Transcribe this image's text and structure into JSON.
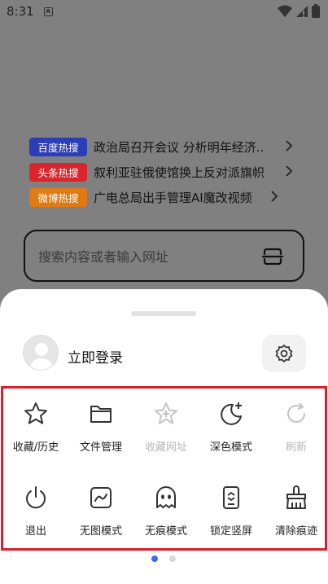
{
  "status_bar": {
    "time": "8:31",
    "app_icon_letter": "A"
  },
  "hot_searches": [
    {
      "badge": "百度热搜",
      "color": "#2c3db8",
      "text": "政治局召开会议 分析明年经济.."
    },
    {
      "badge": "头条热搜",
      "color": "#d9262c",
      "text": "叙利亚驻俄使馆换上反对派旗帜"
    },
    {
      "badge": "微博热搜",
      "color": "#e07a12",
      "text": "广电总局出手管理AI魔改视频"
    }
  ],
  "search": {
    "placeholder": "搜索内容或者输入网址"
  },
  "sheet": {
    "login_label": "立即登录",
    "menu_items": [
      {
        "label": "收藏/历史",
        "icon": "star-icon",
        "enabled": true
      },
      {
        "label": "文件管理",
        "icon": "folder-icon",
        "enabled": true
      },
      {
        "label": "收藏网址",
        "icon": "star-add-icon",
        "enabled": false
      },
      {
        "label": "深色模式",
        "icon": "moon-icon",
        "enabled": true
      },
      {
        "label": "刷新",
        "icon": "refresh-icon",
        "enabled": false
      },
      {
        "label": "退出",
        "icon": "power-icon",
        "enabled": true
      },
      {
        "label": "无图模式",
        "icon": "no-image-icon",
        "enabled": true
      },
      {
        "label": "无痕模式",
        "icon": "ghost-icon",
        "enabled": true
      },
      {
        "label": "锁定竖屏",
        "icon": "lock-portrait-icon",
        "enabled": true
      },
      {
        "label": "清除痕迹",
        "icon": "broom-icon",
        "enabled": true
      }
    ],
    "page_indicator": {
      "pages": 2,
      "active": 1
    }
  },
  "colors": {
    "accent_dot": "#3d6cf0",
    "frame": "#d6202a"
  }
}
